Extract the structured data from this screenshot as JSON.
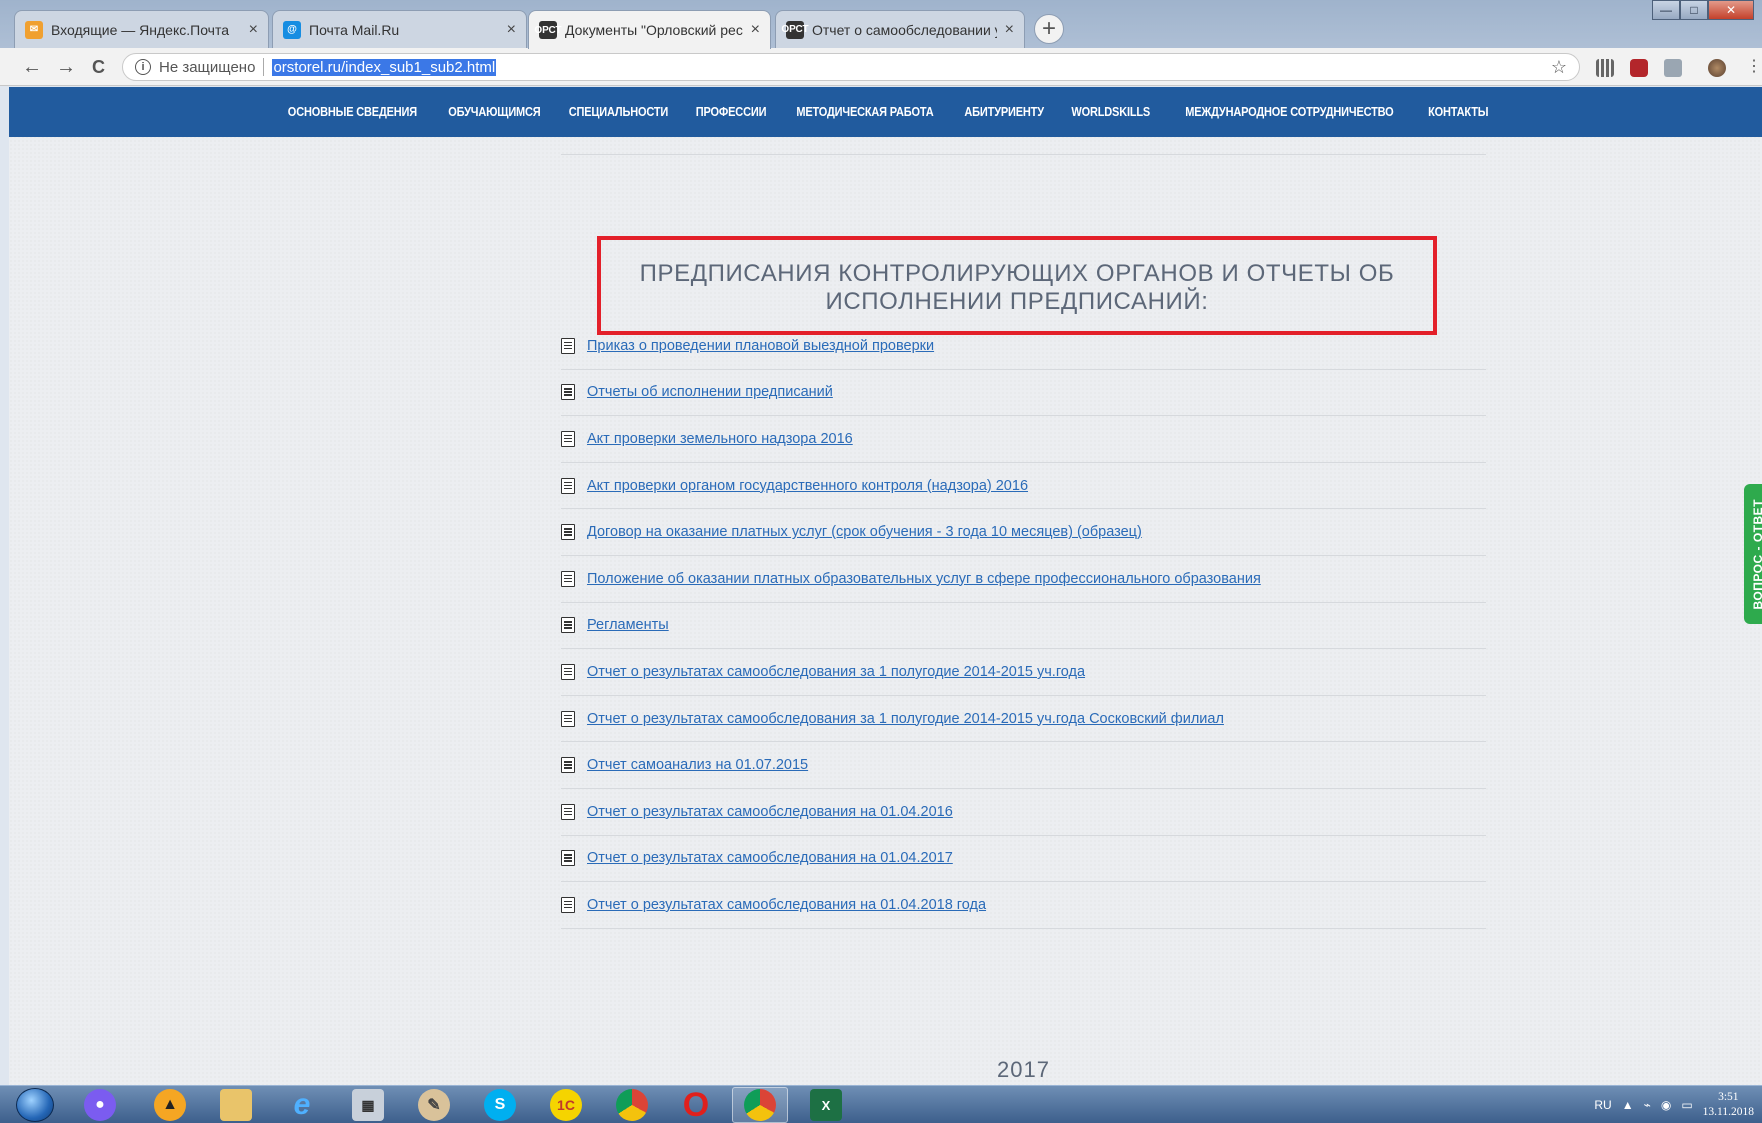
{
  "browser": {
    "tabs": [
      {
        "title": "Входящие — Яндекс.Почта",
        "favicon": "yandex-mail-icon",
        "color": "#f0a030",
        "active": false
      },
      {
        "title": "Почта Mail.Ru",
        "favicon": "mailru-icon",
        "color": "#168de2",
        "active": false
      },
      {
        "title": "Документы \"Орловский реставр",
        "favicon": "site-icon",
        "color": "#333333",
        "active": true
      },
      {
        "title": "Отчет о самообследовании учр",
        "favicon": "site-icon",
        "color": "#333333",
        "active": false
      }
    ],
    "new_tab_label": "+",
    "nav": {
      "back": "←",
      "forward": "→",
      "reload": "C"
    },
    "omnibox": {
      "info_glyph": "i",
      "security_label": "Не защищено",
      "url": "orstorel.ru/index_sub1_sub2.html",
      "star": "☆"
    },
    "window_controls": {
      "minimize": "—",
      "maximize": "□",
      "close": "✕"
    }
  },
  "site": {
    "nav_items": [
      "ОСНОВНЫЕ СВЕДЕНИЯ",
      "ОБУЧАЮЩИМСЯ",
      "СПЕЦИАЛЬНОСТИ",
      "ПРОФЕССИИ",
      "МЕТОДИЧЕСКАЯ РАБОТА",
      "АБИТУРИЕНТУ",
      "WORLDSKILLS",
      "МЕЖДУНАРОДНОЕ СОТРУДНИЧЕСТВО",
      "КОНТАКТЫ"
    ],
    "heading": "ПРЕДПИСАНИЯ КОНТРОЛИРУЮЩИХ ОРГАНОВ И ОТЧЕТЫ ОБ ИСПОЛНЕНИИ ПРЕДПИСАНИЙ:",
    "heading_highlight_color": "#e3202a",
    "documents": [
      "Приказ о проведении плановой выездной проверки",
      "Отчеты об исполнении предписаний",
      "Акт проверки земельного надзора 2016",
      "Акт проверки органом государственного контроля (надзора) 2016",
      "Договор на оказание платных услуг (срок обучения - 3 года 10 месяцев) (образец)",
      "Положение об оказании платных образовательных услуг в сфере профессионального образования",
      "Регламенты",
      "Отчет о результатах самообследования за 1 полугодие 2014-2015 уч.года",
      "Отчет о результатах самообследования за 1 полугодие 2014-2015 уч.года Сосковский филиал",
      "Отчет самоанализ на 01.07.2015",
      "Отчет о результатах самообследования на 01.04.2016",
      "Отчет о результатах самообследования на 01.04.2017",
      "Отчет о результатах самообследования на 01.04.2018 года"
    ],
    "year": "2017",
    "qa_tab": "ВОПРОС - ОТВЕТ",
    "colors": {
      "nav_bg": "#215b9e",
      "link": "#2a6bb8",
      "qa_bg": "#2eaa4d"
    }
  },
  "taskbar": {
    "apps": [
      "voice-assistant-icon",
      "avast-icon",
      "file-explorer-icon",
      "internet-explorer-icon",
      "calculator-icon",
      "paint-icon",
      "skype-icon",
      "1c-icon",
      "chrome-icon",
      "opera-icon",
      "chrome-profile-icon",
      "excel-icon"
    ],
    "tray": {
      "lang": "RU",
      "time": "3:51",
      "date": "13.11.2018"
    }
  }
}
